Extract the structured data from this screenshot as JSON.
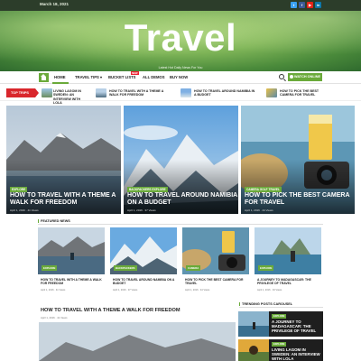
{
  "topbar": {
    "date": "March 18, 2021",
    "social": [
      {
        "icon": "twitter-icon",
        "glyph": "t",
        "color": "#3aa1f2"
      },
      {
        "icon": "facebook-icon",
        "glyph": "f",
        "color": "#3b5998"
      },
      {
        "icon": "youtube-icon",
        "glyph": "▶",
        "color": "#e62117"
      },
      {
        "icon": "linkedin-icon",
        "glyph": "in",
        "color": "#0e76a8"
      }
    ]
  },
  "header": {
    "title": "Travel",
    "tagline": "Latest Hot Daily News For You"
  },
  "nav": {
    "home_icon": "home-icon",
    "items": [
      "HOME",
      "TRAVEL TIPS ▾",
      "BUCKET LISTS",
      "ALL DEMOS",
      "BUY NOW"
    ],
    "new_badge": "NEW",
    "watch_label": "WATCH ONLINE",
    "accent": "#6aaa3a"
  },
  "ticker": {
    "label": "TOP TRIPS",
    "items": [
      "LIVING LAGOM IN SWEDEN: AN INTERVIEW WITH LOLA",
      "HOW TO TRAVEL WITH A THEME A WALK FOR FREEDOM",
      "HOW TO TRAVEL AROUND NAMIBIA IN A BUDGET",
      "HOW TO PICK THE BEST CAMERA FOR TRAVEL"
    ]
  },
  "hero": [
    {
      "category": "EXPLORE",
      "title": "HOW TO TRAVEL WITH A THEME A WALK FOR FREEDOM",
      "meta": "April 1, 2016 · 41 Views"
    },
    {
      "category": "BACKPACKERS  EXPLORE",
      "title": "HOW TO TRAVEL AROUND NAMIBIA ON A BUDGET",
      "meta": "April 1, 2016 · 37 Views"
    },
    {
      "category": "CAMERA  GOLF  TRAVEL",
      "title": "HOW TO PICK THE BEST CAMERA FOR TRAVEL",
      "meta": "April 1, 2016 · 44 Views"
    }
  ],
  "featured": {
    "heading": "FEATURED NEWS",
    "items": [
      {
        "category": "EXPLORE",
        "title": "HOW TO TRAVEL WITH A THEME A WALK FOR FREEDOM",
        "meta": "April 1, 2016 · 41 Views"
      },
      {
        "category": "BACKPACKERS",
        "title": "HOW TO TRAVEL AROUND NAMIBIA ON A BUDGET",
        "meta": "April 1, 2016 · 37 Views"
      },
      {
        "category": "CAMERA",
        "title": "HOW TO PICK THE BEST CAMERA FOR TRAVEL",
        "meta": "April 1, 2016 · 44 Views"
      },
      {
        "category": "EXPLORE",
        "title": "A JOURNEY TO MADAGASCAR: THE PRIVILEGE OF TRAVEL",
        "meta": "April 1, 2016 · 34 Views"
      }
    ]
  },
  "main_post": {
    "title": "HOW TO TRAVEL WITH A THEME A WALK FOR FREEDOM",
    "meta": "April 1, 2016 · 41 Views"
  },
  "sidebar": {
    "heading": "TRENDING POSTS CAROUSEL",
    "items": [
      {
        "category": "EXPLORE",
        "title": "A JOURNEY TO MADAGASCAR: THE PRIVILEGE OF TRAVEL"
      },
      {
        "category": "EXPLORE",
        "title": "LIVING LAGOM IN SWEDEN: AN INTERVIEW WITH LOLA"
      }
    ]
  }
}
